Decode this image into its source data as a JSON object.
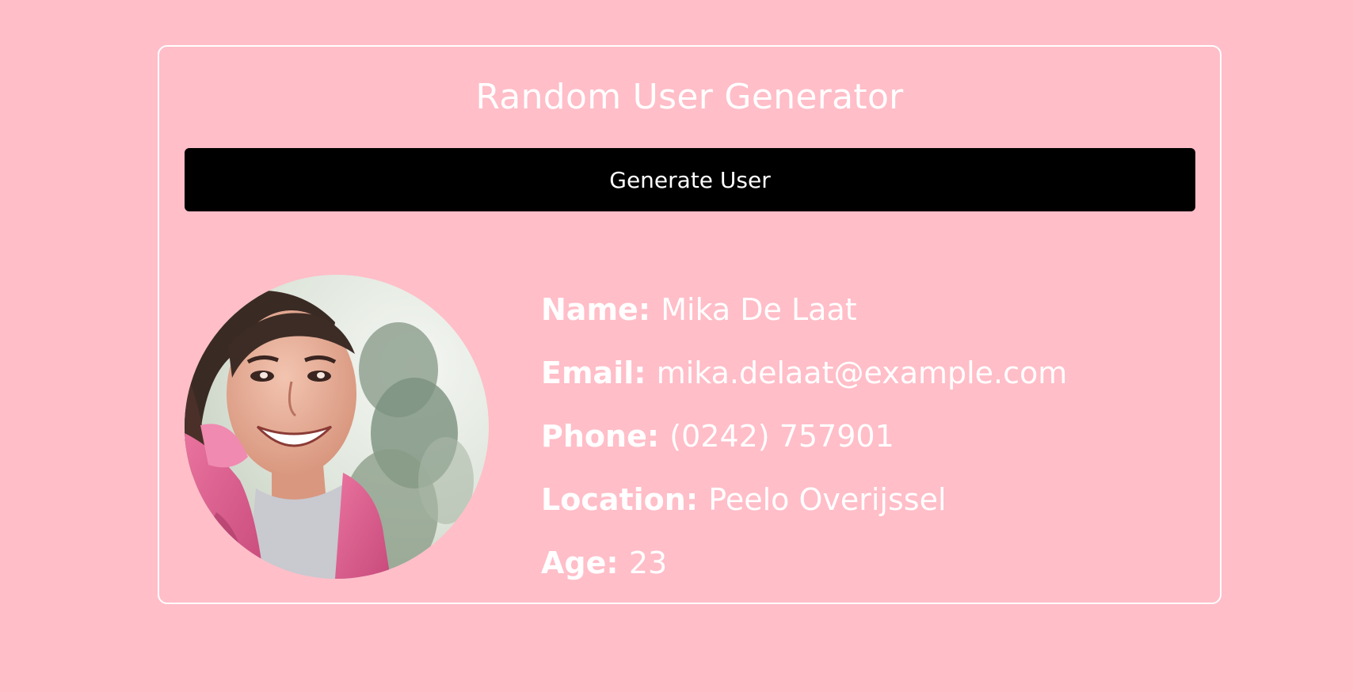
{
  "title": "Random User Generator",
  "button": {
    "label": "Generate User"
  },
  "avatar": {
    "icon": "user-photo",
    "alt": "Mika De Laat"
  },
  "user": {
    "name_label": "Name:",
    "name": "Mika De Laat",
    "email_label": "Email:",
    "email": "mika.delaat@example.com",
    "phone_label": "Phone:",
    "phone": "(0242) 757901",
    "location_label": "Location:",
    "location": "Peelo Overijssel",
    "age_label": "Age:",
    "age": "23"
  },
  "colors": {
    "background": "#ffbec8",
    "text": "#ffffff",
    "button": "#000000",
    "border": "#ffffff"
  }
}
